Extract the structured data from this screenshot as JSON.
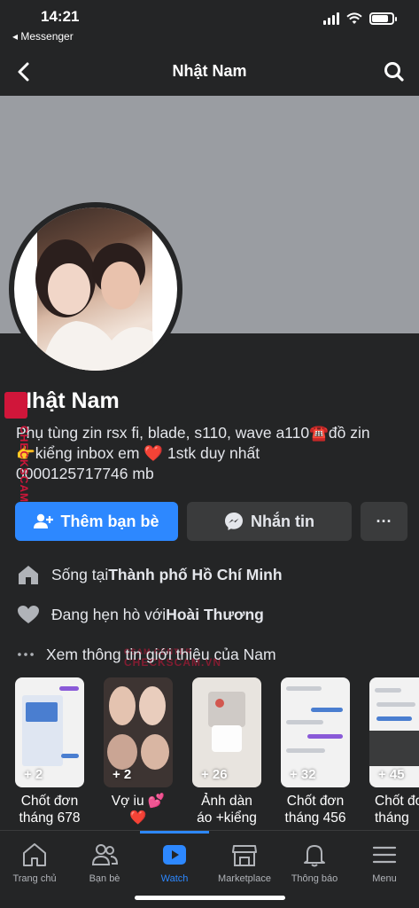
{
  "status_bar": {
    "time": "14:21",
    "back_app": "◂ Messenger",
    "battery_percent": 80
  },
  "header": {
    "title": "Nhật Nam",
    "back_icon": "chevron-left-icon",
    "search_icon": "search-icon"
  },
  "profile": {
    "name": "Nhật Nam",
    "bio_line1": "Phụ tùng zin rsx fi, blade, s110, wave a110☎️đồ zin",
    "bio_line2": "👉kiểng inbox em ❤️ 1stk duy nhất",
    "bio_line3": "0000125717746 mb"
  },
  "buttons": {
    "add_friend": "Thêm bạn bè",
    "message": "Nhắn tin",
    "more": "···"
  },
  "details": {
    "lives_prefix": "Sống tại ",
    "lives_place": "Thành phố Hồ Chí Minh",
    "relation_prefix": "Đang hẹn hò với ",
    "relation_person": "Hoài Thương",
    "about": "Xem thông tin giới thiệu của Nam"
  },
  "highlights": [
    {
      "count": "+ 2",
      "line1": "Chốt đơn",
      "line2": "tháng 678"
    },
    {
      "count": "+ 2",
      "line1": "Vợ iu 💕",
      "line2": "❤️"
    },
    {
      "count": "+ 26",
      "line1": "Ảnh dàn",
      "line2": "áo +kiểng"
    },
    {
      "count": "+ 32",
      "line1": "Chốt đơn",
      "line2": "tháng 456"
    },
    {
      "count": "+ 45",
      "line1": "Chốt đơ",
      "line2": "tháng"
    }
  ],
  "watermark": {
    "side": "CHECKSCAM.VN",
    "center": "CHECKSCAM.VN",
    "brand": "CSAM CENTER"
  },
  "tabs": [
    {
      "label": "Trang chủ",
      "icon": "home-icon"
    },
    {
      "label": "Bạn bè",
      "icon": "friends-icon"
    },
    {
      "label": "Watch",
      "icon": "watch-icon"
    },
    {
      "label": "Marketplace",
      "icon": "marketplace-icon"
    },
    {
      "label": "Thông báo",
      "icon": "bell-icon"
    },
    {
      "label": "Menu",
      "icon": "menu-icon"
    }
  ],
  "colors": {
    "accent": "#2d88ff",
    "background": "#242526",
    "button_secondary": "#3a3b3c",
    "watermark": "#d0163a"
  }
}
